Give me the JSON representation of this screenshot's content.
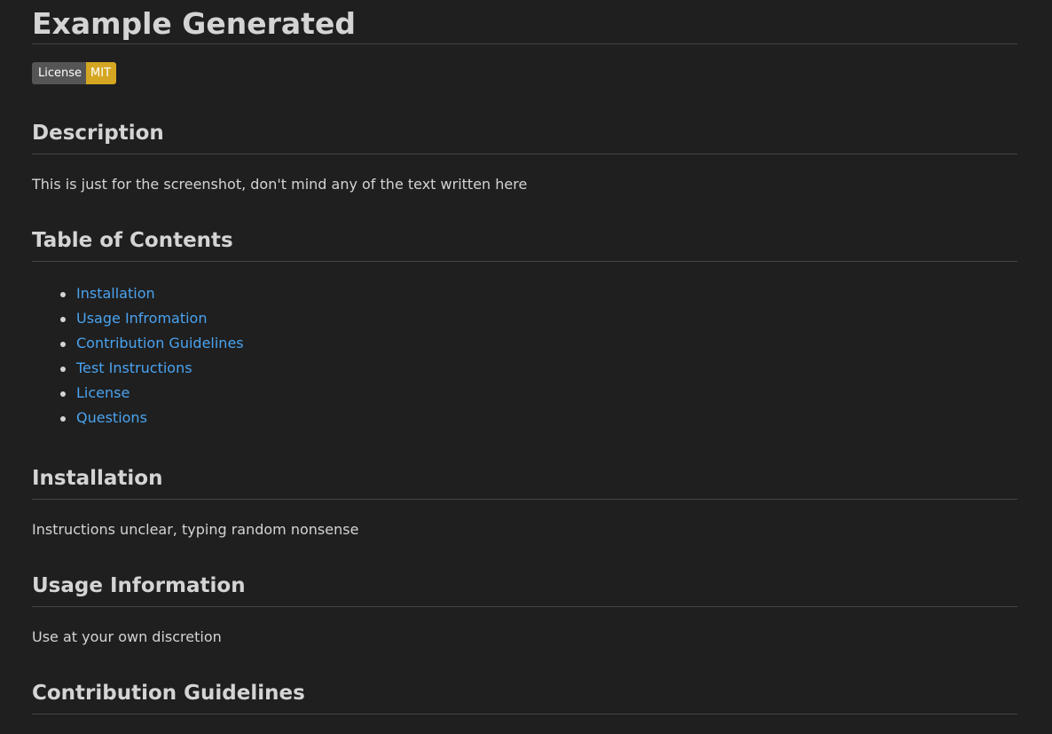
{
  "title": "Example Generated",
  "badge": {
    "label": "License",
    "value": "MIT",
    "label_color": "#555555",
    "value_color": "#d4a622"
  },
  "sections": {
    "description": {
      "heading": "Description",
      "text": "This is just for the screenshot, don't mind any of the text written here"
    },
    "toc": {
      "heading": "Table of Contents",
      "items": [
        "Installation",
        "Usage Infromation",
        "Contribution Guidelines",
        "Test Instructions",
        "License",
        "Questions"
      ]
    },
    "installation": {
      "heading": "Installation",
      "text": "Instructions unclear, typing random nonsense"
    },
    "usage": {
      "heading": "Usage Information",
      "text": "Use at your own discretion"
    },
    "contribution": {
      "heading": "Contribution Guidelines"
    }
  },
  "colors": {
    "background": "#1f1f1f",
    "text": "#d4d4d4",
    "link": "#4aa3f0",
    "rule": "#444444"
  }
}
